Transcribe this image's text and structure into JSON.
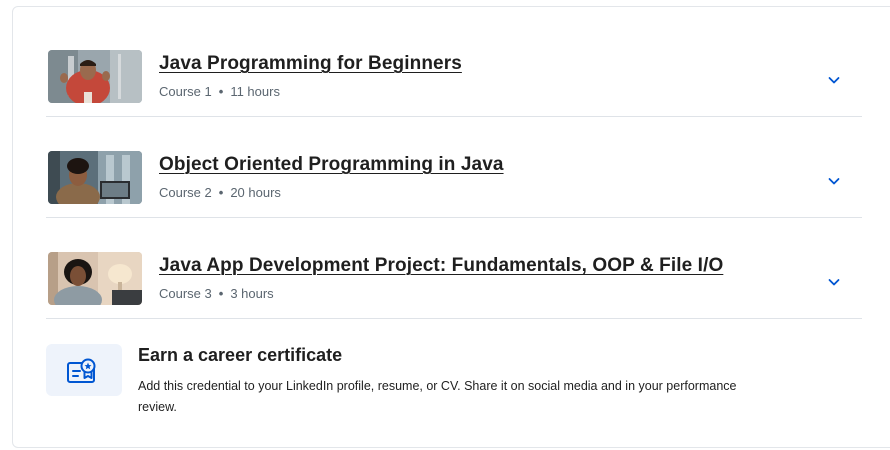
{
  "courses": [
    {
      "title": "Java Programming for Beginners",
      "number": "Course 1",
      "duration": "11 hours",
      "thumb_icon": "smiling-man-photo"
    },
    {
      "title": "Object Oriented Programming in Java",
      "number": "Course 2",
      "duration": "20 hours",
      "thumb_icon": "man-with-laptop-photo"
    },
    {
      "title": "Java App Development Project: Fundamentals, OOP & File I/O",
      "number": "Course 3",
      "duration": "3 hours",
      "thumb_icon": "woman-at-desk-photo"
    }
  ],
  "separator": "•",
  "certificate": {
    "title": "Earn a career certificate",
    "description": "Add this credential to your LinkedIn profile, resume, or CV. Share it on social media and in your performance review.",
    "icon": "certificate-icon"
  },
  "colors": {
    "accent": "#0056d2",
    "badge_bg": "#eef3fb",
    "divider": "#dfe3e8",
    "meta_text": "#5b6670"
  }
}
